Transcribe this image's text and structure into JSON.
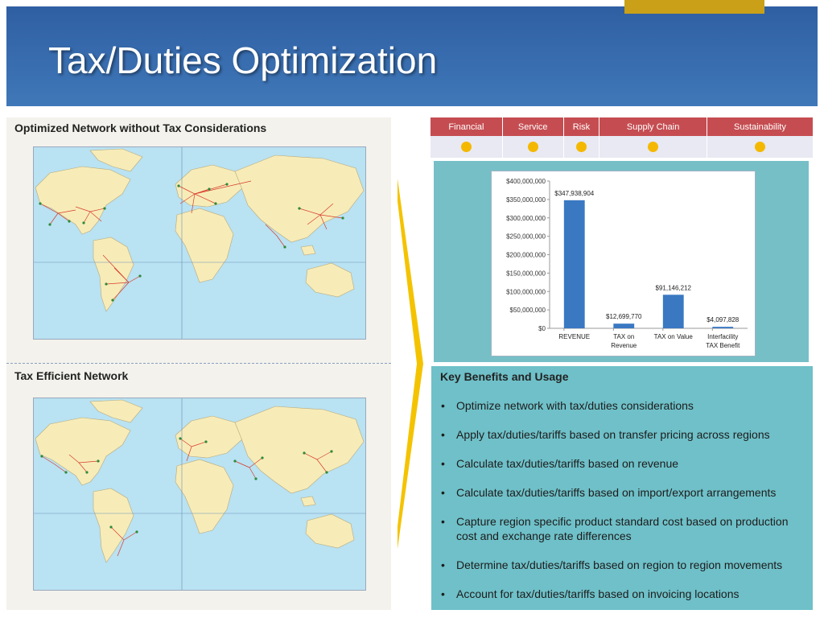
{
  "slide": {
    "title": "Tax/Duties Optimization"
  },
  "left": {
    "top_label": "Optimized Network without Tax Considerations",
    "bottom_label": "Tax Efficient Network"
  },
  "categories": [
    {
      "label": "Financial"
    },
    {
      "label": "Service"
    },
    {
      "label": "Risk"
    },
    {
      "label": "Supply Chain"
    },
    {
      "label": "Sustainability"
    }
  ],
  "chart_data": {
    "type": "bar",
    "categories": [
      "REVENUE",
      "TAX on Revenue",
      "TAX on Value",
      "Interfacility TAX Benefit"
    ],
    "category_lines": [
      [
        "REVENUE"
      ],
      [
        "TAX on",
        "Revenue"
      ],
      [
        "TAX on Value"
      ],
      [
        "Interfacility",
        "TAX Benefit"
      ]
    ],
    "values": [
      347938904,
      12699770,
      91146212,
      4097828
    ],
    "data_labels": [
      "$347,938,904",
      "$12,699,770",
      "$91,146,212",
      "$4,097,828"
    ],
    "yticks": [
      "$0",
      "$50,000,000",
      "$100,000,000",
      "$150,000,000",
      "$200,000,000",
      "$250,000,000",
      "$300,000,000",
      "$350,000,000",
      "$400,000,000"
    ],
    "ylim": [
      0,
      400000000
    ],
    "grid": false,
    "bar_color": "#3a78c2"
  },
  "benefits": {
    "title": "Key Benefits and Usage",
    "items": [
      "Optimize network with tax/duties considerations",
      "Apply tax/duties/tariffs based on transfer pricing across regions",
      "Calculate tax/duties/tariffs based on revenue",
      "Calculate tax/duties/tariffs based on import/export arrangements",
      "Capture region specific product standard cost based on production cost and exchange rate differences",
      "Determine tax/duties/tariffs based on region to region movements",
      "Account for tax/duties/tariffs based on invoicing locations"
    ]
  },
  "colors": {
    "header": "#3466ab",
    "accent_gold": "#c9a017",
    "table_header": "#c54d51",
    "status_dot": "#f5b800",
    "teal_panel": "#6fc0c8"
  }
}
